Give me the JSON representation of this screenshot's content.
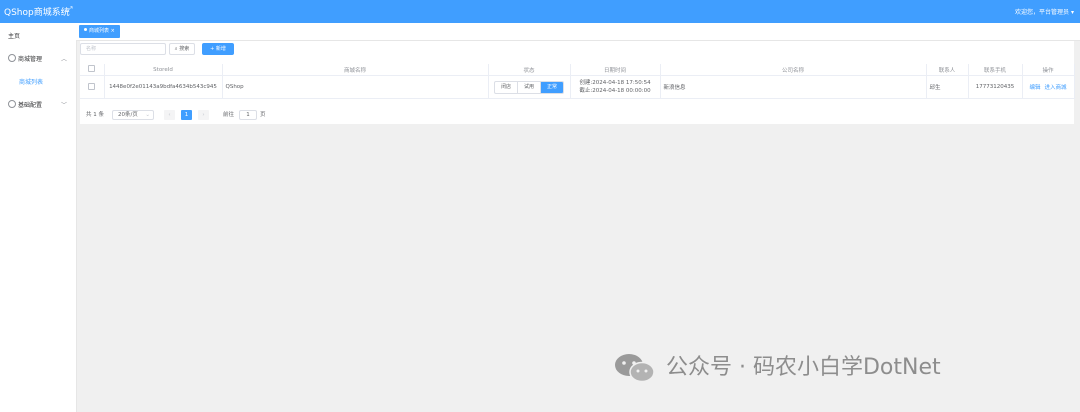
{
  "app": {
    "title": "QShop商城系统",
    "user": "欢迎您，平台管理员"
  },
  "sidebar": {
    "items": [
      {
        "label": "主页"
      },
      {
        "label": "商城管理",
        "expanded": true,
        "children": [
          {
            "label": "商城列表",
            "active": true
          }
        ]
      },
      {
        "label": "基础配置",
        "expanded": false
      }
    ]
  },
  "tabs": [
    {
      "label": "商城列表",
      "active": true
    }
  ],
  "toolbar": {
    "search_placeholder": "名称",
    "search_label": "搜索",
    "add_label": "+ 新增"
  },
  "table": {
    "columns": [
      "StoreId",
      "商城名称",
      "状态",
      "日期时间",
      "公司名称",
      "联系人",
      "联系手机",
      "操作"
    ],
    "rows": [
      {
        "store_id": "1448e0f2e01143a9bdfa4634b543c945",
        "name": "QShop",
        "status_options": [
          "闭店",
          "试用",
          "正常"
        ],
        "status_selected": "正常",
        "created": "创建:2024-04-18 17:50:54",
        "expires": "截止:2024-04-18 00:00:00",
        "company": "新浪信息",
        "contact": "邱生",
        "phone": "17773120435",
        "actions": [
          "编辑",
          "进入商城"
        ]
      }
    ]
  },
  "pagination": {
    "total_text": "共 1 条",
    "page_size": "20条/页",
    "current_page": "1",
    "goto_label": "前往",
    "goto_value": "1",
    "page_unit": "页"
  },
  "watermark": {
    "text": "公众号 · 码农小白学DotNet"
  },
  "colors": {
    "primary": "#409eff",
    "background": "#f0f0f0"
  }
}
